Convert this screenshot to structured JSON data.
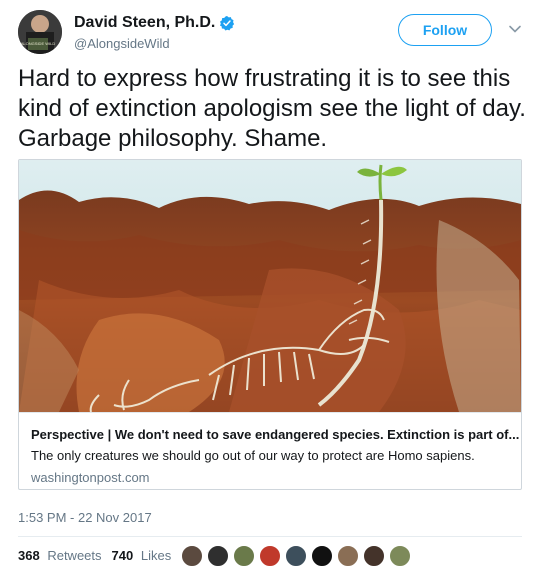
{
  "author": {
    "name": "David Steen, Ph.D.",
    "handle": "@AlongsideWild",
    "avatar_text": "ALONGSIDE WILD"
  },
  "follow_label": "Follow",
  "tweet": {
    "text": "Hard to express how frustrating it is to see this kind of extinction apologism see the light of day. Garbage philosophy. Shame."
  },
  "card": {
    "title": "Perspective | We don't need to save endangered species. Extinction is part of...",
    "description": "The only creatures we should go out of our way to protect are Homo sapiens.",
    "domain": "washingtonpost.com"
  },
  "timestamp": "1:53 PM - 22 Nov 2017",
  "stats": {
    "retweets_count": "368",
    "retweets_label": "Retweets",
    "likes_count": "740",
    "likes_label": "Likes"
  },
  "colors": {
    "accent": "#1da1f2",
    "secondary_text": "#657786"
  },
  "likers": [
    "#5b4a3f",
    "#2f2f2f",
    "#6a7a4a",
    "#c0392b",
    "#3d4f5c",
    "#111111",
    "#8a6e55",
    "#44332a",
    "#7d8a5a"
  ]
}
